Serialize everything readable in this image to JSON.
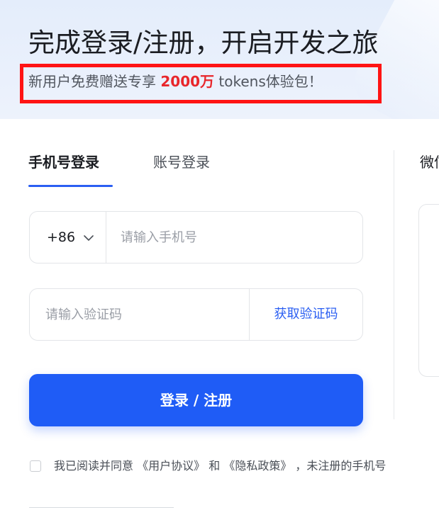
{
  "header": {
    "headline": "完成登录/注册，开启开发之旅",
    "promo_prefix": "新用户免费赠送专享 ",
    "promo_amount": "2000万",
    "promo_suffix": " tokens体验包！"
  },
  "tabs": [
    {
      "label": "手机号登录",
      "active": true
    },
    {
      "label": "账号登录",
      "active": false
    }
  ],
  "wechat": {
    "title": "微信"
  },
  "phone_form": {
    "country_code": "+86",
    "phone_placeholder": "请输入手机号",
    "code_placeholder": "请输入验证码",
    "get_code_label": "获取验证码",
    "submit_label": "登录 / 注册"
  },
  "agreement": {
    "text_1": "我已阅读并同意",
    "user_agreement": "《用户协议》",
    "text_2": " 和 ",
    "privacy_policy": "《隐私政策》",
    "text_3": " ，未注册的手机号"
  },
  "colors": {
    "accent": "#1f5cf6",
    "promo_highlight": "#e8262b",
    "annotation_box": "#ff1414"
  }
}
